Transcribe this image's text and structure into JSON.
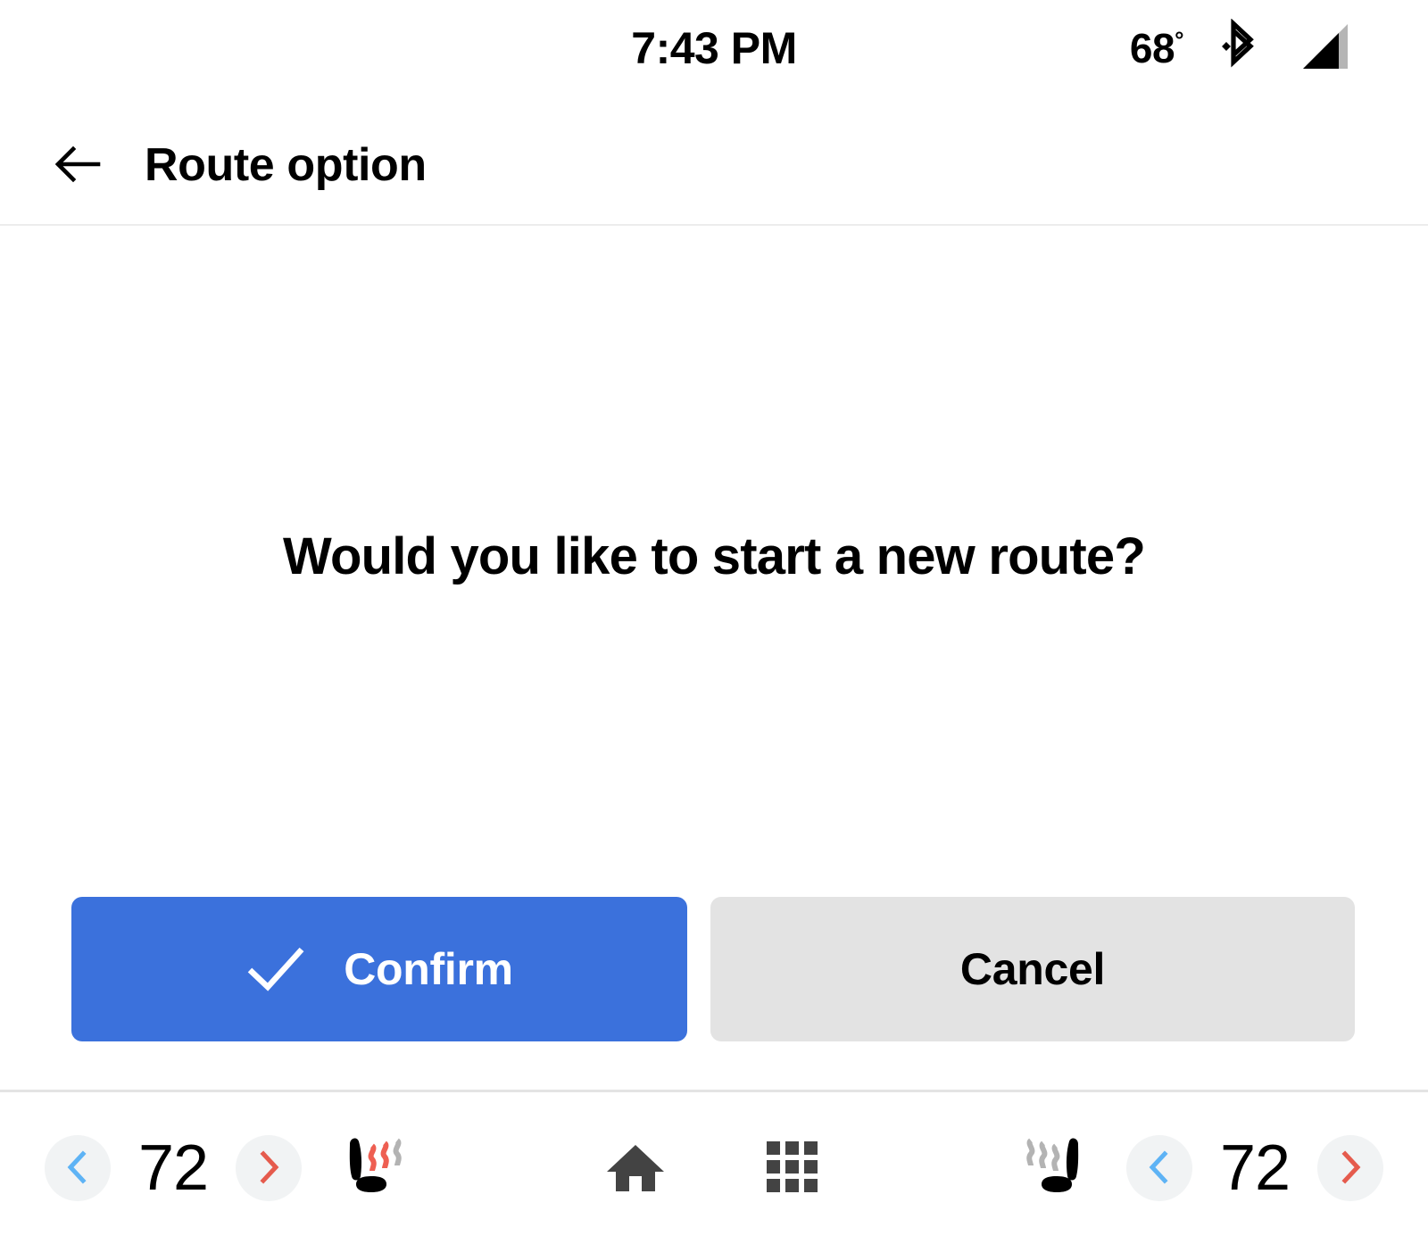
{
  "status_bar": {
    "clock": "7:43 PM",
    "temperature": "68",
    "degree_symbol": "°",
    "bluetooth_icon": "bluetooth-icon",
    "signal_icon": "cellular-signal-icon"
  },
  "header": {
    "back_icon": "back-arrow-icon",
    "title": "Route option"
  },
  "main": {
    "prompt": "Would you like to start a new route?",
    "confirm_button": {
      "label": "Confirm",
      "icon": "check-icon",
      "background_color": "#3b71dc",
      "text_color": "#ffffff"
    },
    "cancel_button": {
      "label": "Cancel",
      "background_color": "#e3e3e3",
      "text_color": "#000000"
    }
  },
  "bottom_bar": {
    "driver_climate": {
      "decrease_icon": "chevron-left-icon",
      "decrease_color": "#5eb3f5",
      "temperature": "72",
      "increase_icon": "chevron-right-icon",
      "increase_color": "#e55b4d"
    },
    "driver_seat_heater": {
      "icon": "heated-seat-icon",
      "active_levels": 2,
      "total_levels": 3,
      "active_color": "#ee5f52",
      "inactive_color": "#b3b3b3"
    },
    "home_button": {
      "icon": "home-icon",
      "color": "#434343"
    },
    "apps_button": {
      "icon": "apps-grid-icon",
      "color": "#434343"
    },
    "passenger_seat_heater": {
      "icon": "heated-seat-icon",
      "active_levels": 0,
      "total_levels": 3,
      "active_color": "#ee5f52",
      "inactive_color": "#b3b3b3"
    },
    "passenger_climate": {
      "decrease_icon": "chevron-left-icon",
      "decrease_color": "#5eb3f5",
      "temperature": "72",
      "increase_icon": "chevron-right-icon",
      "increase_color": "#e55b4d"
    }
  }
}
